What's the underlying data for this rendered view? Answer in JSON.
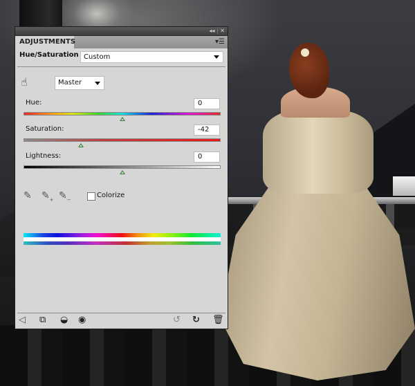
{
  "panel": {
    "window_buttons": {
      "collapse": "◂◂",
      "close": "✕"
    },
    "tab_label": "ADJUSTMENTS",
    "adjustment_title": "Hue/Saturation",
    "preset_value": "Custom",
    "channel_value": "Master",
    "sliders": [
      {
        "label": "Hue:",
        "value": "0",
        "position": 0.5
      },
      {
        "label": "Saturation:",
        "value": "-42",
        "position": 0.29
      },
      {
        "label": "Lightness:",
        "value": "0",
        "position": 0.5
      }
    ],
    "colorize_label": "Colorize",
    "colorize_checked": false,
    "icons": {
      "targeted_adjust": "targeted-adjustment-hand-icon",
      "eyedroppers": [
        "eyedropper-icon",
        "eyedropper-plus-icon",
        "eyedropper-minus-icon"
      ],
      "footer": [
        "back-arrow-icon",
        "clip-to-layer-icon",
        "view-previous-state-icon",
        "visibility-eye-icon",
        "reset-previous-icon",
        "reset-icon",
        "trash-icon"
      ]
    }
  },
  "colors": {
    "panel_bg": "#d6d6d6",
    "thumb": "#3a7a3a"
  }
}
